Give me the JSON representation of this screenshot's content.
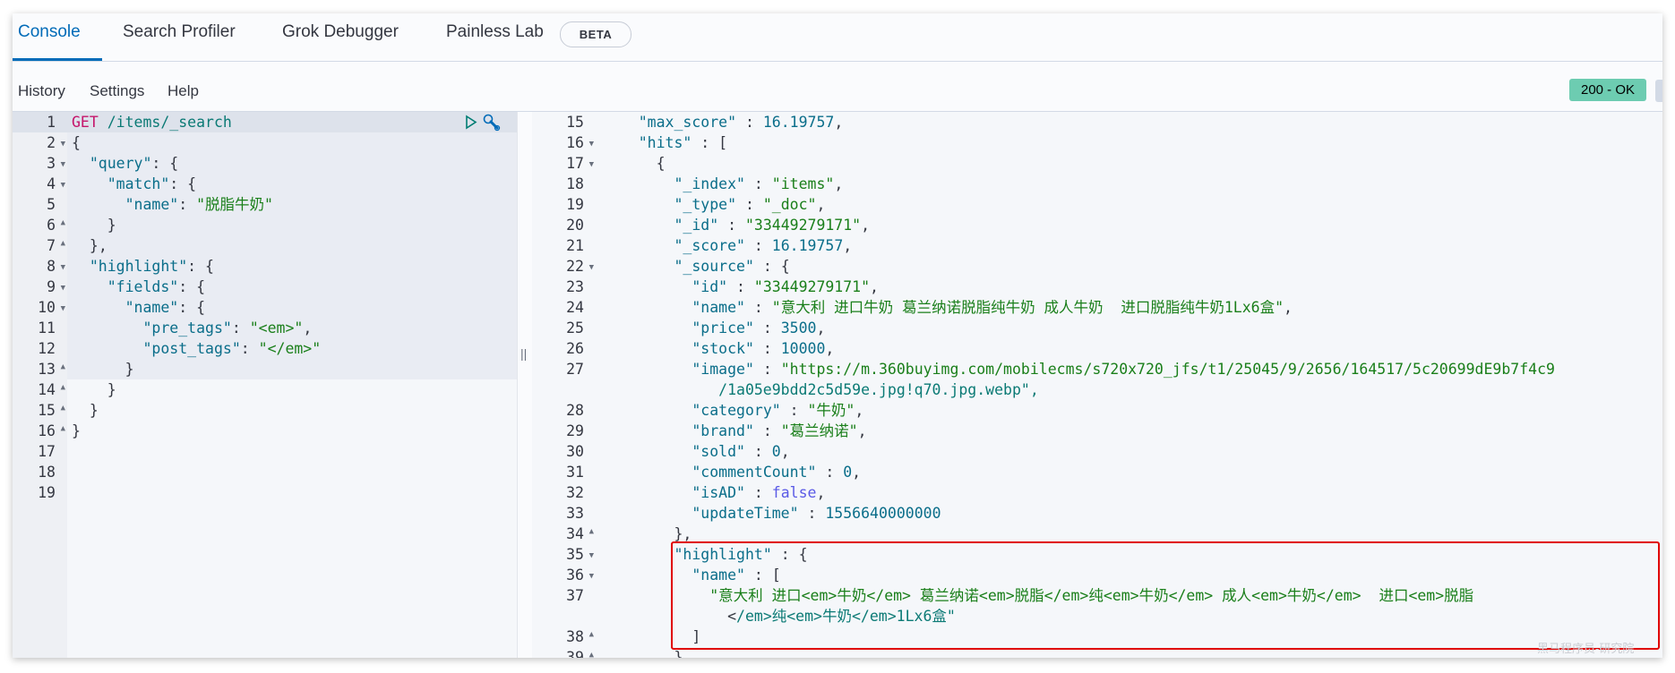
{
  "tabs": [
    {
      "label": "Console",
      "active": true
    },
    {
      "label": "Search Profiler",
      "active": false
    },
    {
      "label": "Grok Debugger",
      "active": false
    },
    {
      "label": "Painless Lab",
      "active": false
    }
  ],
  "beta_badge": "BETA",
  "menu": [
    "History",
    "Settings",
    "Help"
  ],
  "status": {
    "label": "200 - OK",
    "color": "#6dccb1"
  },
  "icons": {
    "run": "play-icon",
    "settings": "wrench-icon"
  },
  "colors": {
    "accent": "#006bb8",
    "annotation_box": "#e00000"
  },
  "request": {
    "line_numbers": [
      "1",
      "2",
      "3",
      "4",
      "5",
      "6",
      "7",
      "8",
      "9",
      "10",
      "11",
      "12",
      "13",
      "14",
      "15",
      "16",
      "17",
      "18",
      "19"
    ],
    "folds": {
      "2": "open",
      "3": "open",
      "4": "open",
      "6": "close",
      "7": "close",
      "8": "open",
      "9": "open",
      "10": "open",
      "13": "close",
      "14": "close",
      "15": "close",
      "16": "close"
    },
    "lines": [
      "GET /items/_search",
      "{",
      "  \"query\": {",
      "    \"match\": {",
      "      \"name\": \"脱脂牛奶\"",
      "    }",
      "  },",
      "  \"highlight\": {",
      "    \"fields\": {",
      "      \"name\": {",
      "        \"pre_tags\": \"<em>\",",
      "        \"post_tags\": \"</em>\"",
      "      }",
      "    }",
      "  }",
      "}"
    ]
  },
  "response": {
    "lines": [
      {
        "n": "15",
        "text": "    \"max_score\" : 16.19757,"
      },
      {
        "n": "16",
        "fold": "open",
        "text": "    \"hits\" : ["
      },
      {
        "n": "17",
        "fold": "open",
        "text": "      {"
      },
      {
        "n": "18",
        "text": "        \"_index\" : \"items\","
      },
      {
        "n": "19",
        "text": "        \"_type\" : \"_doc\","
      },
      {
        "n": "20",
        "text": "        \"_id\" : \"33449279171\","
      },
      {
        "n": "21",
        "text": "        \"_score\" : 16.19757,"
      },
      {
        "n": "22",
        "fold": "open",
        "text": "        \"_source\" : {"
      },
      {
        "n": "23",
        "text": "          \"id\" : \"33449279171\","
      },
      {
        "n": "24",
        "text": "          \"name\" : \"意大利 进口牛奶 葛兰纳诺脱脂纯牛奶 成人牛奶  进口脱脂纯牛奶1Lx6盒\","
      },
      {
        "n": "25",
        "text": "          \"price\" : 3500,"
      },
      {
        "n": "26",
        "text": "          \"stock\" : 10000,"
      },
      {
        "n": "27",
        "text": "          \"image\" : \"https://m.360buyimg.com/mobilecms/s720x720_jfs/t1/25045/9/2656/164517/5c20699dE9b7f4c9"
      },
      {
        "n": "",
        "text": "             /1a05e9bdd2c5d59e.jpg!q70.jpg.webp\","
      },
      {
        "n": "28",
        "text": "          \"category\" : \"牛奶\","
      },
      {
        "n": "29",
        "text": "          \"brand\" : \"葛兰纳诺\","
      },
      {
        "n": "30",
        "text": "          \"sold\" : 0,"
      },
      {
        "n": "31",
        "text": "          \"commentCount\" : 0,"
      },
      {
        "n": "32",
        "text": "          \"isAD\" : false,"
      },
      {
        "n": "33",
        "text": "          \"updateTime\" : 1556640000000"
      },
      {
        "n": "34",
        "fold": "close",
        "text": "        },"
      },
      {
        "n": "35",
        "fold": "open",
        "text": "        \"highlight\" : {"
      },
      {
        "n": "36",
        "fold": "open",
        "text": "          \"name\" : ["
      },
      {
        "n": "37",
        "text": "            \"意大利 进口<em>牛奶</em> 葛兰纳诺<em>脱脂</em>纯<em>牛奶</em> 成人<em>牛奶</em>  进口<em>脱脂"
      },
      {
        "n": "",
        "text": "              </em>纯<em>牛奶</em>1Lx6盒\""
      },
      {
        "n": "38",
        "fold": "close",
        "text": "          ]"
      },
      {
        "n": "39",
        "fold": "close",
        "text": "        }"
      }
    ]
  },
  "watermark": "黑马程序员-研究院"
}
